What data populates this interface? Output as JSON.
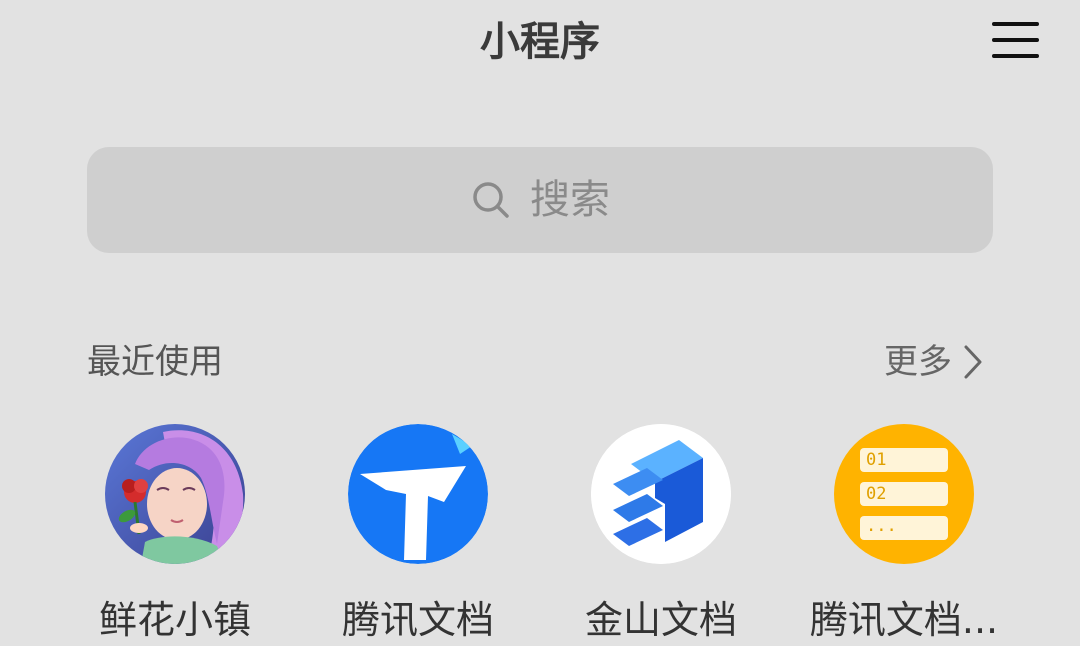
{
  "header": {
    "title": "小程序",
    "menu_icon": "hamburger-menu-icon"
  },
  "search": {
    "placeholder": "搜索",
    "icon": "search-icon"
  },
  "recent": {
    "section_title": "最近使用",
    "more_label": "更多",
    "more_icon": "chevron-right-icon",
    "apps": [
      {
        "label": "鲜花小镇",
        "icon": "flower-town-avatar-icon"
      },
      {
        "label": "腾讯文档",
        "icon": "tencent-docs-icon",
        "color": "#1677f5"
      },
      {
        "label": "金山文档",
        "icon": "kingsoft-docs-icon",
        "color": "#2d6fe6"
      },
      {
        "label": "腾讯文档...",
        "icon": "tencent-docs-list-icon",
        "color": "#ffb300",
        "icon_text": [
          "01",
          "02",
          "..."
        ]
      }
    ]
  }
}
